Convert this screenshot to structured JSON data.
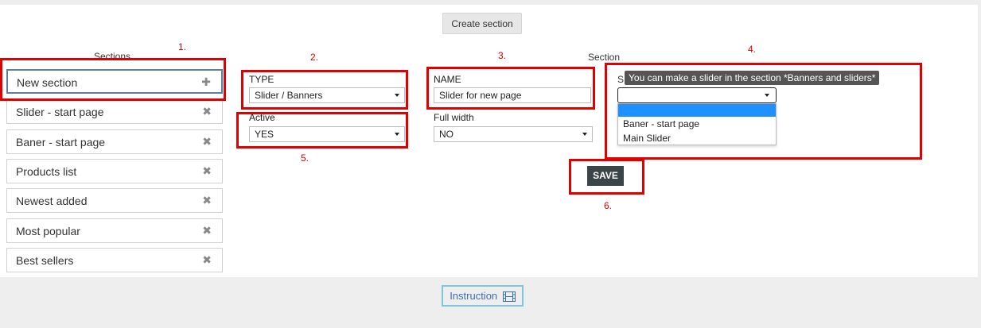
{
  "toolbar": {
    "create_section_label": "Create section"
  },
  "sidebar": {
    "heading": "Sections",
    "items": [
      {
        "label": "New section",
        "icon": "plus-icon"
      },
      {
        "label": "Slider - start page",
        "icon": "delete-icon"
      },
      {
        "label": "Baner - start page",
        "icon": "delete-icon"
      },
      {
        "label": "Products list",
        "icon": "delete-icon"
      },
      {
        "label": "Newest added",
        "icon": "delete-icon"
      },
      {
        "label": "Most popular",
        "icon": "delete-icon"
      },
      {
        "label": "Best sellers",
        "icon": "delete-icon"
      }
    ]
  },
  "form": {
    "type_label": "TYPE",
    "type_value": "Slider / Banners",
    "name_label": "NAME",
    "name_value": "Slider for new page",
    "active_label": "Active",
    "active_value": "YES",
    "full_width_label": "Full width",
    "full_width_value": "NO",
    "section_heading": "Section",
    "section_field_label_fragment": "S",
    "tooltip": "You can make a slider in the section *Banners and sliders*",
    "dropdown_options": [
      "",
      "Baner - start page",
      "Main Slider"
    ],
    "save_label": "SAVE"
  },
  "annotations": [
    "1.",
    "2.",
    "3.",
    "4.",
    "5.",
    "6."
  ],
  "footer": {
    "instruction_label": "Instruction",
    "instruction_icon": "film-icon"
  },
  "colors": {
    "annotation_red": "#e00000",
    "save_bg": "#3a4449",
    "highlight": "#1e90ff",
    "active_border": "#5e7ea5"
  }
}
